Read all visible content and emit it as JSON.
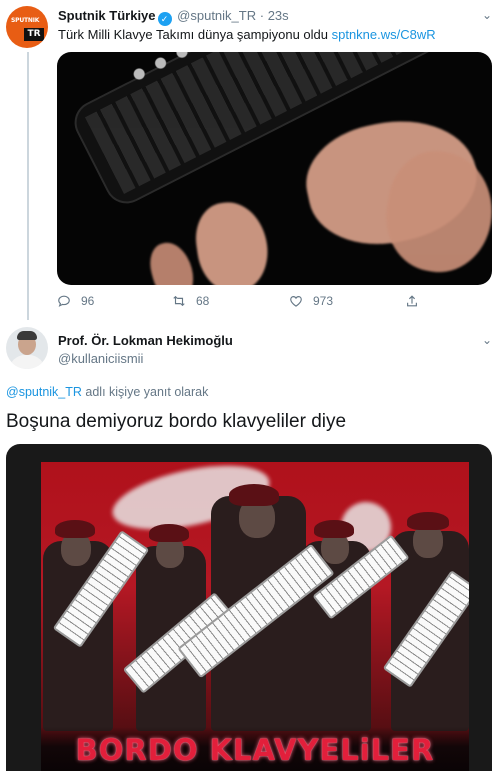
{
  "tweet": {
    "author_name": "Sputnik Türkiye",
    "handle": "@sputnik_TR",
    "separator": "·",
    "time": "23s",
    "avatar_text_top": "SPUTNIK",
    "avatar_text_bottom": "TR",
    "text": "Türk Milli Klavye Takımı dünya şampiyonu oldu ",
    "link": "sptnkne.ws/C8wR",
    "stats": {
      "replies": "96",
      "retweets": "68",
      "likes": "973"
    }
  },
  "reply": {
    "author_name": "Prof. Ör. Lokman Hekimoğlu",
    "handle": "@kullaniciismii",
    "replying_to_handle": "@sputnik_TR",
    "replying_suffix": " adlı kişiye yanıt olarak",
    "text": "Boşuna demiyoruz bordo klavyeliler diye",
    "image_caption": "BORDO KLAVYELiLER"
  },
  "colors": {
    "accent": "#1b95e0",
    "muted": "#657786",
    "text": "#14171a",
    "verified": "#1da1f2",
    "poster_red": "#b0111b"
  },
  "icons": [
    "verified-icon",
    "chevron-down-icon",
    "reply-icon",
    "retweet-icon",
    "like-icon",
    "share-icon"
  ]
}
